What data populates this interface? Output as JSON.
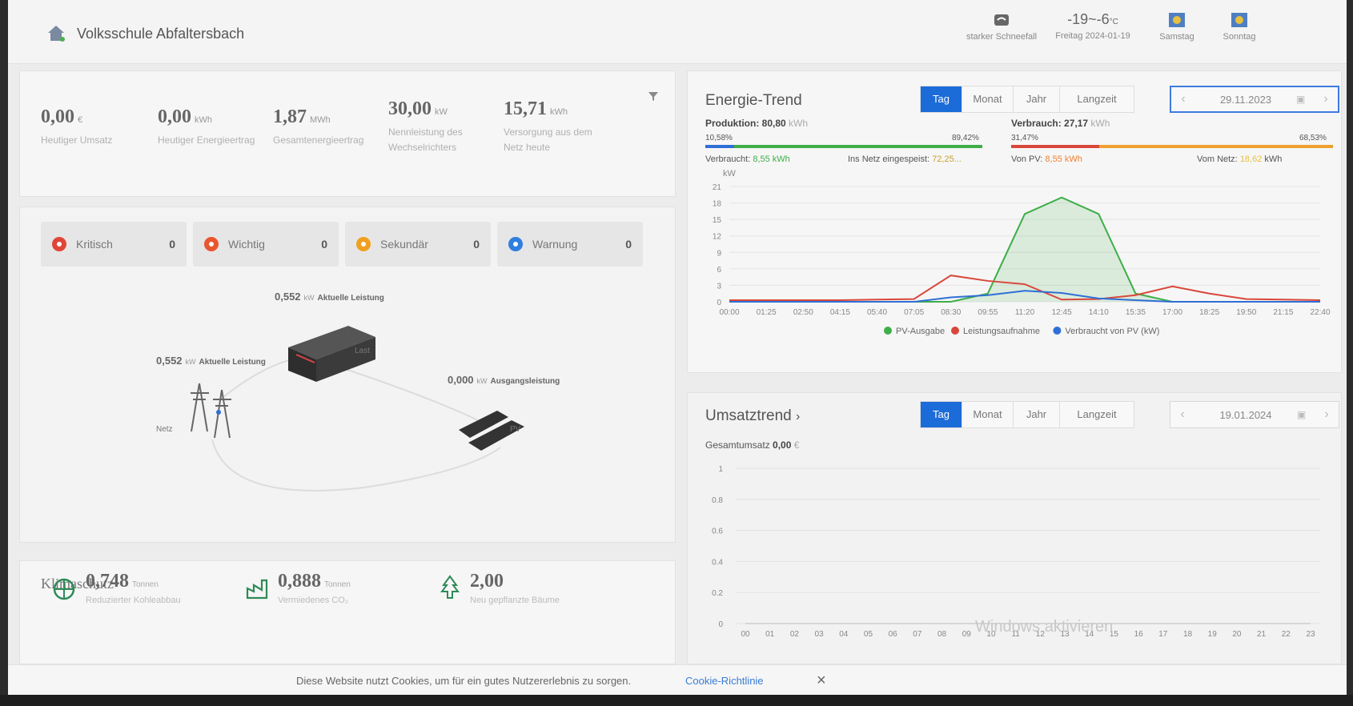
{
  "header": {
    "school_name": "Volksschule Abfaltersbach",
    "weather_desc": "starker Schneefall",
    "temperature": "-19~-6",
    "temp_unit": "°C",
    "date_label": "Freitag 2024-01-19",
    "forecast1": "Samstag",
    "forecast2": "Sonntag"
  },
  "kpis": [
    {
      "value": "0,00",
      "unit": "€",
      "label": "Heutiger Umsatz"
    },
    {
      "value": "0,00",
      "unit": "kWh",
      "label": "Heutiger Energieertrag"
    },
    {
      "value": "1,87",
      "unit": "MWh",
      "label": "Gesamtenergieertrag"
    },
    {
      "value": "30,00",
      "unit": "kW",
      "label": "Nennleistung des Wechselrichters"
    },
    {
      "value": "15,71",
      "unit": "kWh",
      "label": "Versorgung aus dem Netz heute"
    }
  ],
  "alarms": [
    {
      "label": "Kritisch",
      "count": "0",
      "color": "#e0453a"
    },
    {
      "label": "Wichtig",
      "count": "0",
      "color": "#e8572e"
    },
    {
      "label": "Sekundär",
      "count": "0",
      "color": "#f0a020"
    },
    {
      "label": "Warnung",
      "count": "0",
      "color": "#2f7fe0"
    }
  ],
  "flow": {
    "storage_value": "0,552",
    "storage_unit": "kW",
    "storage_label": "Aktuelle Leistung",
    "grid_value": "0,552",
    "grid_unit": "kW",
    "grid_label": "Aktuelle Leistung",
    "pv_value": "0,000",
    "pv_unit": "kW",
    "pv_label": "Ausgangsleistung",
    "load_label": "Last",
    "grid_name": "Netz",
    "pv_name": "PV"
  },
  "klima": {
    "title": "Klimaschutz",
    "items": [
      {
        "value": "0,748",
        "unit": "Tonnen",
        "label": "Reduzierter Kohleabbau"
      },
      {
        "value": "0,888",
        "unit": "Tonnen",
        "label": "Vermiedenes CO₂"
      },
      {
        "value": "2,00",
        "unit": "",
        "label": "Neu gepflanzte Bäume"
      }
    ]
  },
  "energy_trend": {
    "title": "Energie-Trend",
    "tabs": [
      "Tag",
      "Monat",
      "Jahr",
      "Langzeit"
    ],
    "active_tab": "Tag",
    "date": "29.11.2023",
    "production_label": "Produktion:",
    "production_value": "80,80",
    "production_unit": "kWh",
    "prod_pct_left": "10,58%",
    "prod_pct_right": "89,42%",
    "self_use_label": "Verbraucht:",
    "self_use_value": "8,55 kWh",
    "feed_in_label": "Ins Netz eingespeist:",
    "feed_in_value": "72,25...",
    "consumption_label": "Verbrauch:",
    "consumption_value": "27,17",
    "consumption_unit": "kWh",
    "cons_pct_left": "31,47%",
    "cons_pct_right": "68,53%",
    "from_pv_label": "Von PV:",
    "from_pv_value": "8,55 kWh",
    "from_grid_label": "Vom Netz:",
    "from_grid_value": "18,62",
    "from_grid_unit": "kWh",
    "unit_label": "kW",
    "colors": {
      "pv": "#3fae49",
      "load": "#d9473a",
      "self": "#2f6fd6"
    }
  },
  "chart_data": [
    {
      "type": "line",
      "title": "Energie-Trend",
      "ylabel": "kW",
      "ylim": [
        0,
        21
      ],
      "yticks": [
        0,
        3,
        6,
        9,
        12,
        15,
        18,
        21
      ],
      "x": [
        "00:00",
        "01:25",
        "02:50",
        "04:15",
        "05:40",
        "07:05",
        "08:30",
        "09:55",
        "11:20",
        "12:45",
        "14:10",
        "15:35",
        "17:00",
        "18:25",
        "19:50",
        "21:15",
        "22:40"
      ],
      "series": [
        {
          "name": "PV-Ausgabe",
          "color": "#3fae49",
          "values": [
            0,
            0,
            0,
            0,
            0,
            0,
            0,
            1.5,
            16,
            19,
            16,
            1.5,
            0,
            0,
            0,
            0,
            0
          ]
        },
        {
          "name": "Leistungsaufnahme",
          "color": "#d9473a",
          "values": [
            0.3,
            0.3,
            0.3,
            0.3,
            0.4,
            0.5,
            4.8,
            3.8,
            3.2,
            0.4,
            0.5,
            1.2,
            2.8,
            1.5,
            0.5,
            0.4,
            0.3
          ]
        },
        {
          "name": "Verbraucht von PV (kW)",
          "color": "#2f6fd6",
          "values": [
            0,
            0,
            0,
            0,
            0,
            0,
            0.8,
            1.2,
            2.0,
            1.6,
            0.6,
            0.3,
            0,
            0,
            0,
            0,
            0
          ]
        }
      ]
    },
    {
      "type": "line",
      "title": "Umsatztrend",
      "ylim": [
        0,
        1
      ],
      "yticks": [
        0,
        0.2,
        0.4,
        0.6,
        0.8,
        1
      ],
      "x": [
        "00",
        "01",
        "02",
        "03",
        "04",
        "05",
        "06",
        "07",
        "08",
        "09",
        "10",
        "11",
        "12",
        "13",
        "14",
        "15",
        "16",
        "17",
        "18",
        "19",
        "20",
        "21",
        "22",
        "23"
      ],
      "series": [
        {
          "name": "Gesamtumsatz",
          "values": [
            0,
            0,
            0,
            0,
            0,
            0,
            0,
            0,
            0,
            0,
            0,
            0,
            0,
            0,
            0,
            0,
            0,
            0,
            0,
            0,
            0,
            0,
            0,
            0
          ]
        }
      ]
    }
  ],
  "umsatz_trend": {
    "title": "Umsatztrend",
    "tabs": [
      "Tag",
      "Monat",
      "Jahr",
      "Langzeit"
    ],
    "active_tab": "Tag",
    "date": "19.01.2024",
    "total_label": "Gesamtumsatz",
    "total_value": "0,00",
    "total_unit": "€"
  },
  "cookie": {
    "text": "Diese Website nutzt Cookies, um für ein gutes Nutzererlebnis zu sorgen.",
    "link": "Cookie-Richtlinie",
    "close": "×"
  },
  "watermark": "Windows aktivieren"
}
